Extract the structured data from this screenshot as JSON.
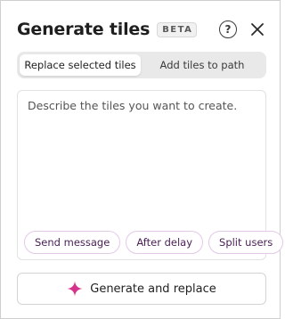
{
  "header": {
    "title": "Generate tiles",
    "badge": "BETA",
    "help_icon": "help-circle-icon",
    "close_icon": "close-icon"
  },
  "tabs": [
    {
      "label": "Replace selected tiles",
      "active": true
    },
    {
      "label": "Add tiles to path",
      "active": false
    }
  ],
  "prompt": {
    "value": "",
    "placeholder": "Describe the tiles you want to create."
  },
  "chips": [
    {
      "label": "Send message"
    },
    {
      "label": "After delay"
    },
    {
      "label": "Split users"
    }
  ],
  "generate": {
    "label": "Generate and replace",
    "icon": "sparkle-icon",
    "icon_color": "#d6338c"
  },
  "colors": {
    "accent_pink": "#d6338c",
    "chip_border": "#e3c8e8",
    "tab_track": "#e9e9e9"
  }
}
